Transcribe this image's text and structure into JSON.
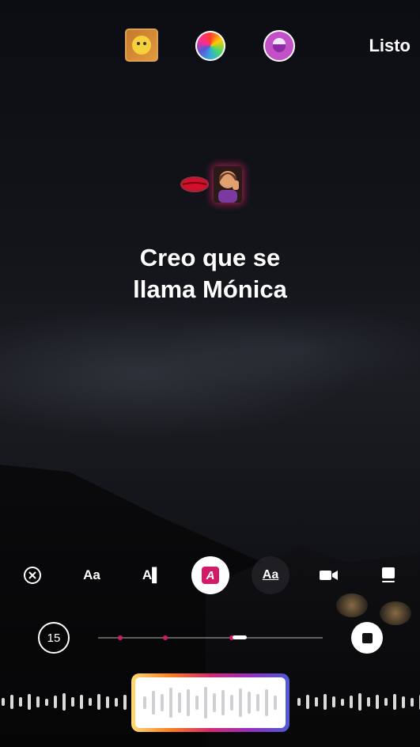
{
  "header": {
    "sticker_icon": "sticker-thumbnail-icon",
    "color_icon": "color-wheel-icon",
    "effect_icon": "text-effect-icon",
    "done_label": "Listo"
  },
  "story": {
    "emoji_sticker": [
      "lips-emoji",
      "woman-whispering-emoji"
    ],
    "caption_line1": "Creo que se",
    "caption_line2": "llama Mónica"
  },
  "text_tools": [
    {
      "name": "close-icon"
    },
    {
      "label": "Aa"
    },
    {
      "label": "A▌"
    },
    {
      "label": "A",
      "active": true
    },
    {
      "label": "Aa"
    },
    {
      "name": "video-icon"
    },
    {
      "name": "card-icon"
    }
  ],
  "timeline": {
    "duration_label": "15",
    "stop_icon": "stop-icon"
  },
  "colors": {
    "accent": "#d11b68",
    "gradient": [
      "#feda75",
      "#fa7e1e",
      "#d62976",
      "#962fbf",
      "#4f5bd5"
    ]
  }
}
